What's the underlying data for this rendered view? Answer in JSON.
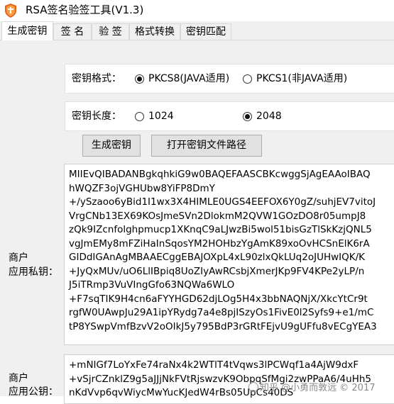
{
  "window": {
    "title": "RSA签名验签工具(V1.3)"
  },
  "tabs": [
    {
      "label": "生成密钥"
    },
    {
      "label": "签 名"
    },
    {
      "label": "验 签"
    },
    {
      "label": "格式转换"
    },
    {
      "label": "密钥匹配"
    }
  ],
  "key_format": {
    "label": "密钥格式：",
    "options": [
      {
        "label": "PKCS8(JAVA适用)",
        "checked": true
      },
      {
        "label": "PKCS1(非JAVA适用)",
        "checked": false
      }
    ]
  },
  "key_length": {
    "label": "密钥长度：",
    "options": [
      {
        "label": "1024",
        "checked": false
      },
      {
        "label": "2048",
        "checked": true
      }
    ]
  },
  "buttons": {
    "generate": "生成密钥",
    "open_path": "打开密钥文件路径"
  },
  "private_key": {
    "label_line1": "商户",
    "label_line2": "应用私钥：",
    "lines": [
      "MIIEvQIBADANBgkqhkiG9w0BAQEFAASCBKcwggSjAgEAAoIBAQ",
      "hWQZF3ojVGHUbw8YiFP8DmY",
      "+/ySzaoo6yBid1I1wx3X4HIMLE0UGS4EEFOX6Y0gZ/suhjEV7vitoJ",
      "VrgCNb13EX69KOsJmeSVn2DlokmM2QVW1GOzDO8r05umpJ8",
      "zQk9IZcnfolghpmucp1XKnqC9aLJwzBi5wol51bisGzTlSkKzjQNL5",
      "vgJmEMy8mFZiHaInSqosYM2HOHbzYgAmK89xoOvHCSnElK6rA",
      "GIDdIGAnAgMBAAECggEBAJOXpL4xL90zlxQkLUq2oJUHwIQK/K",
      "+JyQxMUv/uO6LlIBpiq8UoZIyAwRCsbjXmerJKp9FV4KPe2yLP/n",
      "J5iTRmp3VuVIngGfo63NQWa6WLO",
      "+F7sqTIK9H4cn6aFYYHGD62djLOg5H4x3bbNAQNjX/XkcYtCr9t",
      "rgfW0UAwpJu29A1ipYRydg7a4e8pjISzyOs1FivE0l2Syfs9+e1/mC",
      "tP8YSwpVmfBzvV2oOIkJ5y795BdP3rGRtFEjvU9gUFfu8vECgYEA3"
    ]
  },
  "public_key": {
    "label_line1": "商户",
    "label_line2": "应用公钥：",
    "lines": [
      "+mNIGf7LoYxFe74raNx4k2WTlT4tVqws3lPCWqf1a4AjW9dxF",
      "+vSjrCZnklZ9g5aJJjNkFVtRjswzvK9ObpqSfMgi2zwPPaA6/4uHh5",
      "nKdVvp6qvWiycMwYucKJedW4rBs05UpCs40DS"
    ]
  },
  "watermark": {
    "text": "知乎 @小勇而敦远 © 2017"
  }
}
